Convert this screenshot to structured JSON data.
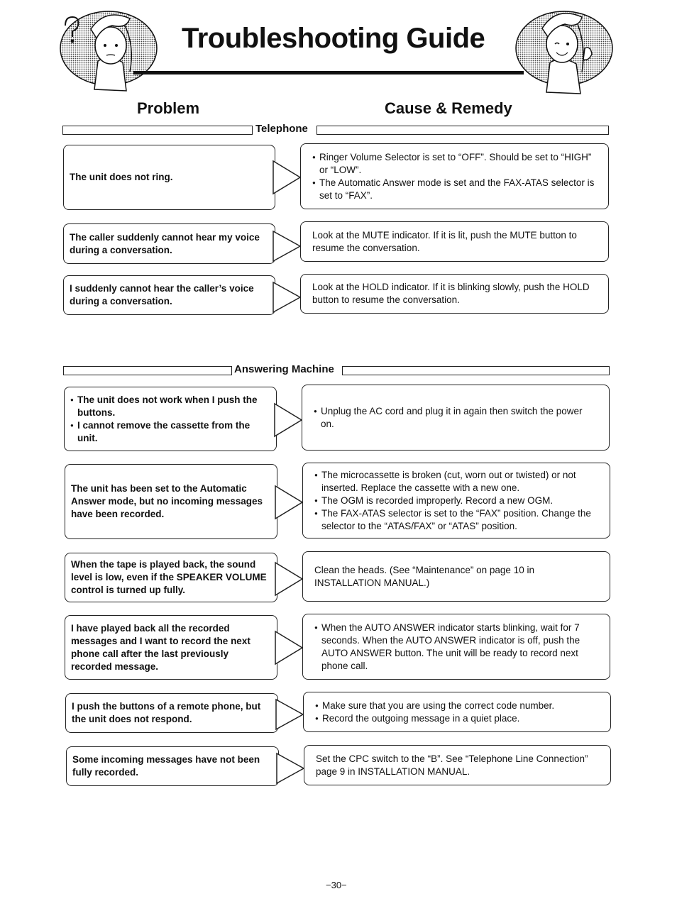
{
  "header": {
    "title": "Troubleshooting Guide",
    "left_mascot": "confused-girl-illustration",
    "right_mascot": "smiling-girl-ok-illustration"
  },
  "columns": {
    "problem": "Problem",
    "cause_remedy": "Cause & Remedy"
  },
  "sections": [
    {
      "label": "Telephone",
      "rows": [
        {
          "problem": "The unit does not ring.",
          "remedy_bullets": [
            "Ringer Volume Selector is set to “OFF”. Should be set to “HIGH” or “LOW”.",
            "The Automatic Answer mode is set and the FAX-ATAS selector is set to “FAX”."
          ]
        },
        {
          "problem": "The caller suddenly cannot hear my voice during a conversation.",
          "remedy": "Look at the MUTE indicator. If it is lit, push the MUTE button to resume the conversation."
        },
        {
          "problem": "I suddenly cannot hear the caller’s voice during a conversation.",
          "remedy": "Look at the HOLD indicator. If it is blinking slowly, push the HOLD button to resume the conversation."
        }
      ]
    },
    {
      "label": "Answering Machine",
      "rows": [
        {
          "problem_bullets": [
            "The unit does not work when I push the buttons.",
            "I cannot remove the cassette from the unit."
          ],
          "remedy_bullets": [
            "Unplug the AC cord and plug it in again then switch the power on."
          ]
        },
        {
          "problem": "The unit has been set to the Automatic Answer mode, but no incoming messages have been recorded.",
          "remedy_bullets": [
            "The microcassette is broken (cut, worn out or twisted) or not inserted. Replace the cassette with a new one.",
            "The OGM is recorded improperly. Record a new OGM.",
            "The FAX-ATAS selector is set to the “FAX” position. Change the selector to the “ATAS/FAX” or “ATAS” position."
          ]
        },
        {
          "problem": "When the tape is played back, the sound level is low, even if the SPEAKER VOLUME control is turned up fully.",
          "remedy": "Clean the heads. (See “Maintenance” on page 10 in INSTALLATION MANUAL.)"
        },
        {
          "problem": "I have played back all the recorded messages and I want to record the next phone call after the last previously recorded message.",
          "remedy_bullets": [
            "When the AUTO ANSWER indicator starts blinking, wait for 7 seconds. When the AUTO ANSWER indicator is off, push the AUTO ANSWER button. The unit will be ready to record next phone call."
          ]
        },
        {
          "problem": "I push the buttons of a remote phone, but the unit does not respond.",
          "remedy_bullets": [
            "Make sure that you are using the correct code number.",
            "Record the outgoing message in a quiet place."
          ]
        },
        {
          "problem": "Some incoming messages have not been fully recorded.",
          "remedy": "Set the CPC switch to the “B”. See “Telephone Line Connection” page 9 in INSTALLATION MANUAL."
        }
      ]
    }
  ],
  "footer": {
    "page_number": "−30−"
  }
}
